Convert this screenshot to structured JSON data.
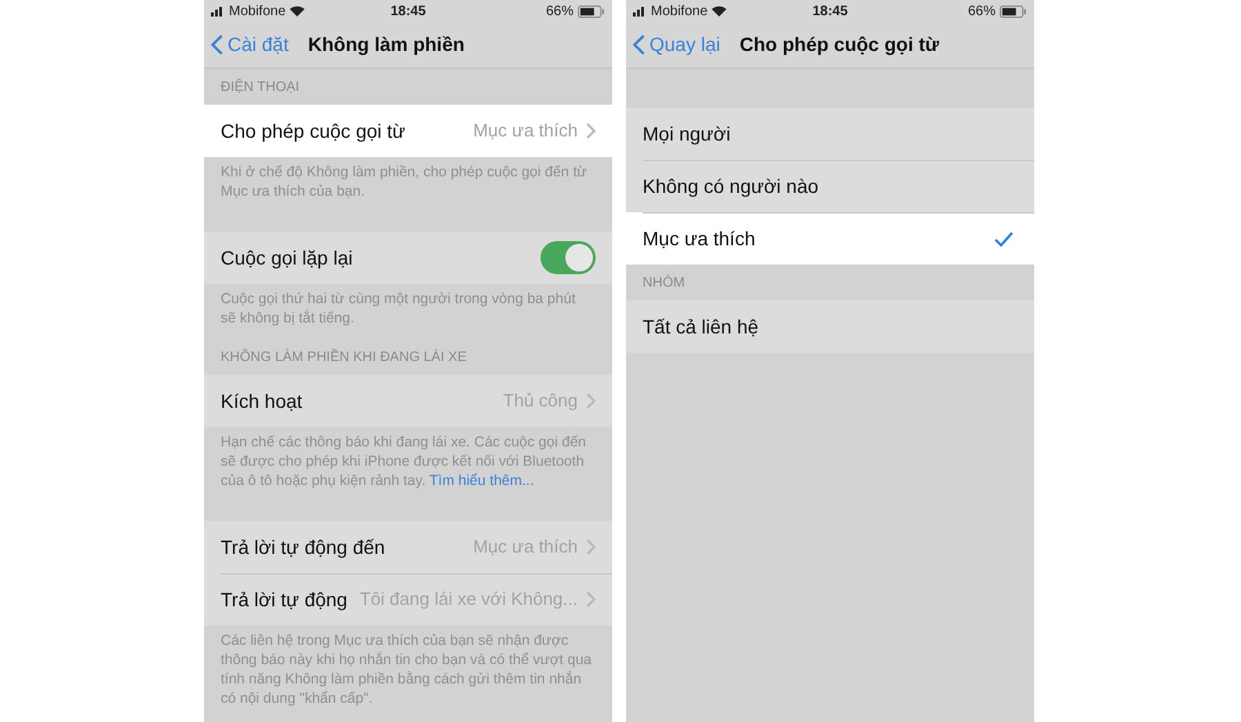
{
  "screens": [
    {
      "status_bar": {
        "carrier": "Mobifone",
        "time": "18:45",
        "battery": "66%"
      },
      "nav": {
        "back": "Cài đặt",
        "title": "Không làm phiền"
      },
      "sections": [
        {
          "header": "ĐIỆN THOẠI",
          "rows": [
            {
              "kind": "disclosure",
              "label": "Cho phép cuộc gọi từ",
              "value": "Mục ưa thích",
              "highlighted": true
            }
          ],
          "footer": "Khi ở chế độ Không làm phiền, cho phép cuộc gọi đến từ Mục ưa thích của bạn."
        },
        {
          "rows": [
            {
              "kind": "toggle",
              "label": "Cuộc gọi lặp lại",
              "on": true,
              "highlighted": false
            }
          ],
          "footer": "Cuộc gọi thứ hai từ cùng một người trong vòng ba phút sẽ không bị tắt tiếng."
        },
        {
          "header": "KHÔNG LÀM PHIỀN KHI ĐANG LÁI XE",
          "rows": [
            {
              "kind": "disclosure",
              "label": "Kích hoạt",
              "value": "Thủ công",
              "highlighted": false
            }
          ],
          "footer": "Hạn chế các thông báo khi đang lái xe. Các cuộc gọi đến sẽ được cho phép khi iPhone được kết nối với Bluetooth của ô tô hoặc phụ kiện rảnh tay.",
          "footer_link": "Tìm hiểu thêm..."
        },
        {
          "rows": [
            {
              "kind": "disclosure",
              "label": "Trả lời tự động đến",
              "value": "Mục ưa thích",
              "highlighted": false
            },
            {
              "kind": "disclosure",
              "label": "Trả lời tự động",
              "value": "Tôi đang lái xe với Không...",
              "highlighted": false
            }
          ],
          "footer": "Các liên hệ trong Mục ưa thích của bạn sẽ nhận được thông báo này khi họ nhắn tin cho bạn và có thể vượt qua tính năng Không làm phiền bằng cách gửi thêm tin nhắn có nội dung \"khẩn cấp\"."
        }
      ]
    },
    {
      "status_bar": {
        "carrier": "Mobifone",
        "time": "18:45",
        "battery": "66%"
      },
      "nav": {
        "back": "Quay lại",
        "title": "Cho phép cuộc gọi từ"
      },
      "sections": [
        {
          "rows": [
            {
              "kind": "choice",
              "label": "Mọi người",
              "selected": false,
              "highlighted": false
            },
            {
              "kind": "choice",
              "label": "Không có người nào",
              "selected": false,
              "highlighted": false
            },
            {
              "kind": "choice",
              "label": "Mục ưa thích",
              "selected": true,
              "highlighted": true
            }
          ]
        },
        {
          "header": "NHÓM",
          "rows": [
            {
              "kind": "choice",
              "label": "Tất cả liên hệ",
              "selected": false,
              "highlighted": false
            }
          ]
        }
      ]
    }
  ]
}
